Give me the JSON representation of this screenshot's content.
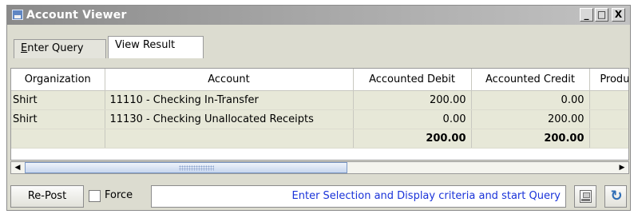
{
  "window": {
    "title": "Account Viewer",
    "minimize": "_",
    "maximize": "□",
    "close": "X"
  },
  "tabs": [
    {
      "label_underlined": "E",
      "label_rest": "nter Query"
    },
    {
      "label": "View Result",
      "selected": true
    }
  ],
  "grid": {
    "columns": [
      "Organization",
      "Account",
      "Accounted Debit",
      "Accounted Credit",
      "Product"
    ],
    "rows": [
      {
        "organization": "Shirt",
        "account": "11110 - Checking In-Transfer",
        "debit": "200.00",
        "credit": "0.00",
        "product": ""
      },
      {
        "organization": "Shirt",
        "account": "11130 - Checking Unallocated Receipts",
        "debit": "0.00",
        "credit": "200.00",
        "product": ""
      }
    ],
    "totals": {
      "organization": "",
      "account": "",
      "debit": "200.00",
      "credit": "200.00",
      "product": ""
    }
  },
  "scrollbar": {
    "left_arrow": "◀",
    "right_arrow": "▶"
  },
  "footer": {
    "repost_label": "Re-Post",
    "force_label": "Force",
    "force_checked": false,
    "status_text": "Enter Selection and Display criteria and start Query",
    "print_icon": "print-icon",
    "refresh_icon": "refresh-icon",
    "refresh_glyph": "↻"
  },
  "colors": {
    "title_gradient_start": "#8a8a8a",
    "grid_row_background": "#e7e8d8",
    "status_text": "#1a33d9"
  }
}
